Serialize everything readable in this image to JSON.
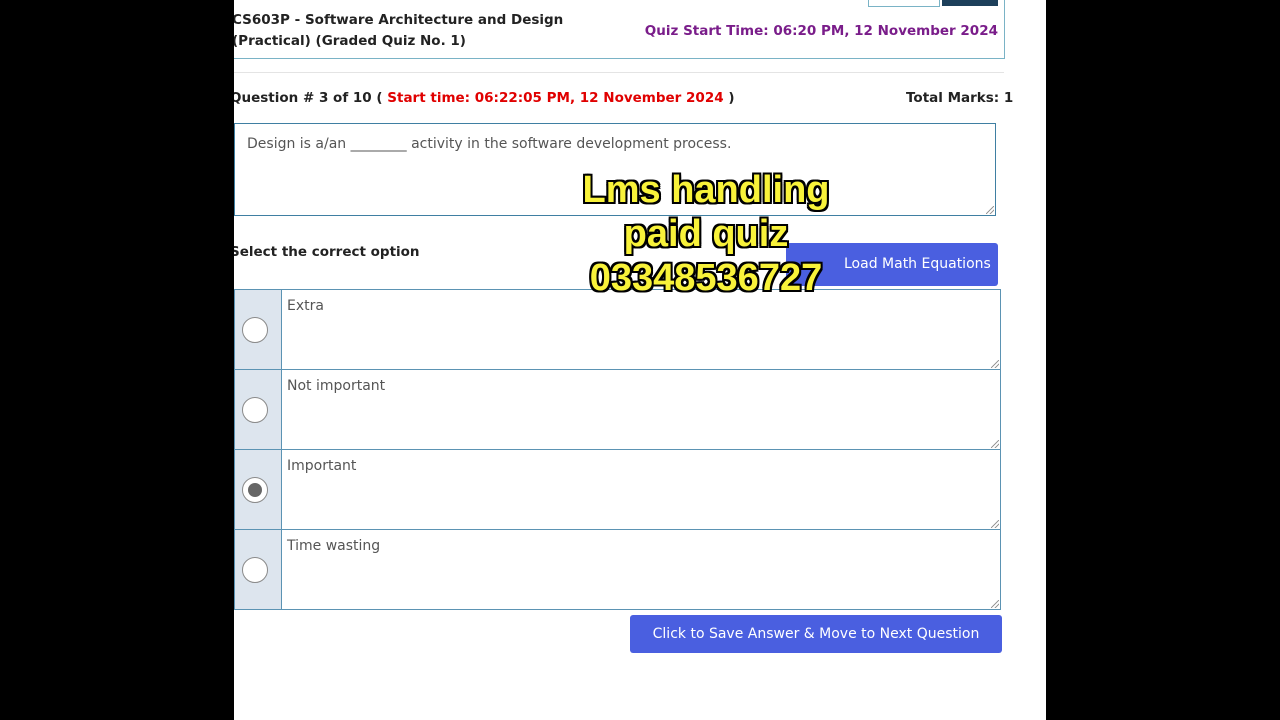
{
  "header": {
    "course_line1": "CS603P - Software Architecture and Design",
    "course_line2": "(Practical) (Graded Quiz No. 1)",
    "quiz_start_time": "Quiz Start Time: 06:20 PM, 12 November 2024"
  },
  "question": {
    "number_text": "Question # 3 of 10 (",
    "start_time": "Start time: 06:22:05 PM, 12 November 2024",
    "close_paren": ")",
    "total_marks": "Total Marks: 1",
    "text": "Design is a/an ________ activity in the software development process."
  },
  "select_label": "Select the correct option",
  "math_button_label": "Load Math Equations",
  "options": [
    {
      "label": "Extra",
      "selected": false
    },
    {
      "label": "Not important",
      "selected": false
    },
    {
      "label": "Important",
      "selected": true
    },
    {
      "label": "Time wasting",
      "selected": false
    }
  ],
  "save_button_label": "Click to Save Answer & Move to Next Question",
  "overlay": {
    "line1": "Lms handling",
    "line2": "paid quiz",
    "line3": "03348536727",
    "color": "#f8f23a"
  },
  "colors": {
    "accent_button": "#4a5fe0",
    "start_time_red": "#e00000",
    "quiz_time_purple": "#7a1d8a",
    "border_blue": "#5b93b3"
  }
}
